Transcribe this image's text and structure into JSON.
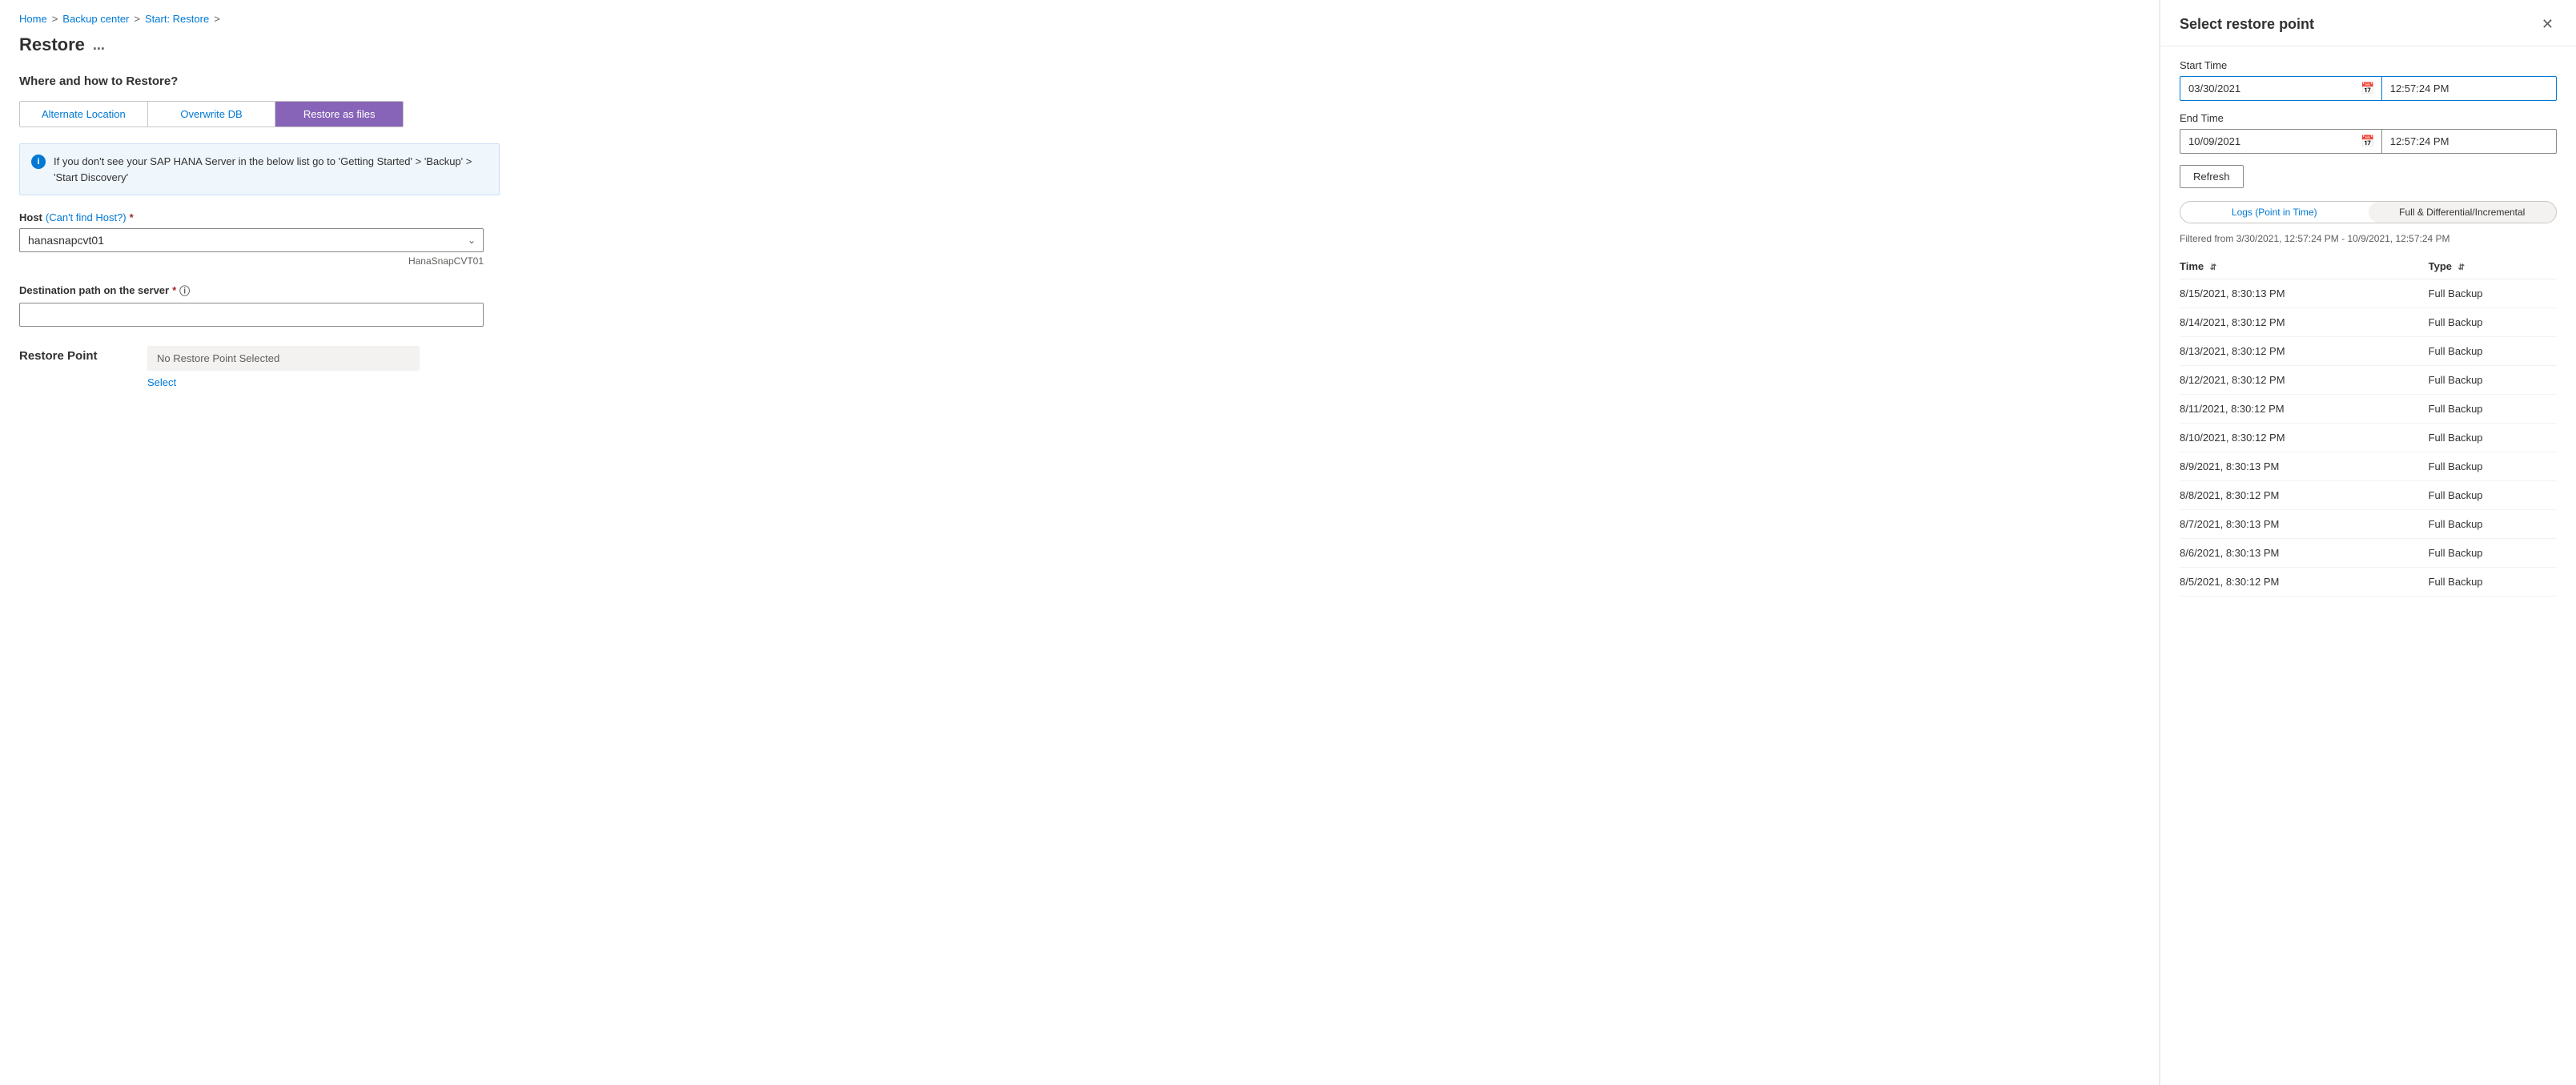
{
  "breadcrumb": {
    "home": "Home",
    "backup_center": "Backup center",
    "start_restore": "Start: Restore",
    "separator": ">"
  },
  "page": {
    "title": "Restore",
    "ellipsis": "...",
    "section_heading": "Where and how to Restore?"
  },
  "tabs": [
    {
      "id": "alternate",
      "label": "Alternate Location",
      "active": false
    },
    {
      "id": "overwrite",
      "label": "Overwrite DB",
      "active": false
    },
    {
      "id": "restore_files",
      "label": "Restore as files",
      "active": true
    }
  ],
  "info_box": {
    "icon": "i",
    "text": "If you don't see your SAP HANA Server in the below list go to 'Getting Started' > 'Backup' > 'Start Discovery'"
  },
  "host_field": {
    "label": "Host",
    "link_text": "(Can't find Host?)",
    "required": true,
    "value": "hanasnapcvt01",
    "hint": "HanaSnapCVT01"
  },
  "destination_field": {
    "label": "Destination path on the server",
    "required": true,
    "value": ""
  },
  "restore_point": {
    "label": "Restore Point",
    "value": "No Restore Point Selected",
    "select_label": "Select"
  },
  "right_panel": {
    "title": "Select restore point",
    "close_icon": "✕",
    "start_time": {
      "label": "Start Time",
      "date": "03/30/2021",
      "time": "12:57:24 PM"
    },
    "end_time": {
      "label": "End Time",
      "date": "10/09/2021",
      "time": "12:57:24 PM"
    },
    "refresh_label": "Refresh",
    "toggle_tabs": [
      {
        "id": "logs",
        "label": "Logs (Point in Time)",
        "active": false
      },
      {
        "id": "full",
        "label": "Full & Differential/Incremental",
        "active": true
      }
    ],
    "filter_text": "Filtered from 3/30/2021, 12:57:24 PM - 10/9/2021, 12:57:24 PM",
    "table_headers": [
      {
        "id": "time",
        "label": "Time"
      },
      {
        "id": "type",
        "label": "Type"
      }
    ],
    "table_rows": [
      {
        "time": "8/15/2021, 8:30:13 PM",
        "type": "Full Backup"
      },
      {
        "time": "8/14/2021, 8:30:12 PM",
        "type": "Full Backup"
      },
      {
        "time": "8/13/2021, 8:30:12 PM",
        "type": "Full Backup"
      },
      {
        "time": "8/12/2021, 8:30:12 PM",
        "type": "Full Backup"
      },
      {
        "time": "8/11/2021, 8:30:12 PM",
        "type": "Full Backup"
      },
      {
        "time": "8/10/2021, 8:30:12 PM",
        "type": "Full Backup"
      },
      {
        "time": "8/9/2021, 8:30:13 PM",
        "type": "Full Backup"
      },
      {
        "time": "8/8/2021, 8:30:12 PM",
        "type": "Full Backup"
      },
      {
        "time": "8/7/2021, 8:30:13 PM",
        "type": "Full Backup"
      },
      {
        "time": "8/6/2021, 8:30:13 PM",
        "type": "Full Backup"
      },
      {
        "time": "8/5/2021, 8:30:12 PM",
        "type": "Full Backup"
      }
    ]
  }
}
